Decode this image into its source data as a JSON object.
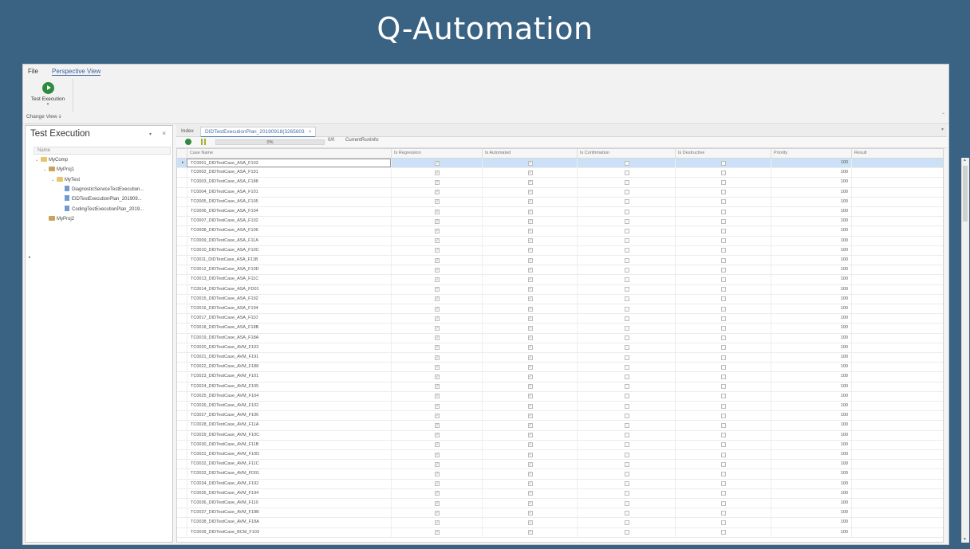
{
  "banner": {
    "title": "Q-Automation"
  },
  "menu": {
    "file": "File",
    "perspective": "Perspective View"
  },
  "ribbon": {
    "run_label": "Test Execution",
    "group_label": "Change View",
    "group_icon": "ↆ"
  },
  "left_panel": {
    "title": "Test Execution",
    "header": "Name",
    "tree": [
      {
        "label": "MyComp",
        "level": 0,
        "icon": "folder",
        "expander": "v"
      },
      {
        "label": "MyProj1",
        "level": 1,
        "icon": "project",
        "expander": "v"
      },
      {
        "label": "MyTest",
        "level": 2,
        "icon": "folder",
        "expander": "v"
      },
      {
        "label": "DiagnosticServiceTestExecution...",
        "level": 3,
        "icon": "file",
        "expander": ""
      },
      {
        "label": "EIDTestExecutionPlan_201909...",
        "level": 3,
        "icon": "file",
        "expander": ""
      },
      {
        "label": "CodingTestExecutionPlan_2019...",
        "level": 3,
        "icon": "file",
        "expander": ""
      },
      {
        "label": "MyProj2",
        "level": 1,
        "icon": "project",
        "expander": ""
      }
    ]
  },
  "tabs": {
    "index": "Index",
    "active": "DIDTestExecutionPlan_20190918(3265603",
    "close": "×"
  },
  "toolbar": {
    "progress": 0,
    "progress_label": "0%",
    "run_count": "0/0",
    "run_info": "CurrentRunInfo:"
  },
  "grid": {
    "columns": [
      "Case Name",
      "Is Regression",
      "Is Automated",
      "Is Confirmation",
      "Is Destructive",
      "Priority",
      "Result"
    ],
    "rows": [
      {
        "name": "TC0001_DIDTestCase_ASA_F103",
        "reg": true,
        "auto": true,
        "conf": false,
        "dest": false,
        "prio": "100"
      },
      {
        "name": "TC0002_DIDTestCase_ASA_F191",
        "reg": true,
        "auto": true,
        "conf": false,
        "dest": false,
        "prio": "100"
      },
      {
        "name": "TC0003_DIDTestCase_ASA_F188",
        "reg": true,
        "auto": true,
        "conf": false,
        "dest": false,
        "prio": "100"
      },
      {
        "name": "TC0004_DIDTestCase_ASA_F101",
        "reg": true,
        "auto": true,
        "conf": false,
        "dest": false,
        "prio": "100"
      },
      {
        "name": "TC0005_DIDTestCase_ASA_F105",
        "reg": true,
        "auto": true,
        "conf": false,
        "dest": false,
        "prio": "100"
      },
      {
        "name": "TC0006_DIDTestCase_ASA_F104",
        "reg": true,
        "auto": true,
        "conf": false,
        "dest": false,
        "prio": "100"
      },
      {
        "name": "TC0007_DIDTestCase_ASA_F102",
        "reg": true,
        "auto": true,
        "conf": false,
        "dest": false,
        "prio": "100"
      },
      {
        "name": "TC0008_DIDTestCase_ASA_F106",
        "reg": true,
        "auto": true,
        "conf": false,
        "dest": false,
        "prio": "100"
      },
      {
        "name": "TC0009_DIDTestCase_ASA_F11A",
        "reg": true,
        "auto": true,
        "conf": false,
        "dest": false,
        "prio": "100"
      },
      {
        "name": "TC0010_DIDTestCase_ASA_F10C",
        "reg": true,
        "auto": true,
        "conf": false,
        "dest": false,
        "prio": "100"
      },
      {
        "name": "TC0011_DIDTestCase_ASA_F11B",
        "reg": true,
        "auto": true,
        "conf": false,
        "dest": false,
        "prio": "100"
      },
      {
        "name": "TC0012_DIDTestCase_ASA_F10D",
        "reg": true,
        "auto": true,
        "conf": false,
        "dest": false,
        "prio": "100"
      },
      {
        "name": "TC0013_DIDTestCase_ASA_F11C",
        "reg": true,
        "auto": true,
        "conf": false,
        "dest": false,
        "prio": "100"
      },
      {
        "name": "TC0014_DIDTestCase_ASA_FD01",
        "reg": true,
        "auto": true,
        "conf": false,
        "dest": false,
        "prio": "100"
      },
      {
        "name": "TC0015_DIDTestCase_ASA_F192",
        "reg": true,
        "auto": true,
        "conf": false,
        "dest": false,
        "prio": "100"
      },
      {
        "name": "TC0016_DIDTestCase_ASA_F194",
        "reg": true,
        "auto": true,
        "conf": false,
        "dest": false,
        "prio": "100"
      },
      {
        "name": "TC0017_DIDTestCase_ASA_F110",
        "reg": true,
        "auto": true,
        "conf": false,
        "dest": false,
        "prio": "100"
      },
      {
        "name": "TC0018_DIDTestCase_ASA_F18B",
        "reg": true,
        "auto": true,
        "conf": false,
        "dest": false,
        "prio": "100"
      },
      {
        "name": "TC0019_DIDTestCase_ASA_F18A",
        "reg": true,
        "auto": true,
        "conf": false,
        "dest": false,
        "prio": "100"
      },
      {
        "name": "TC0020_DIDTestCase_AVM_F103",
        "reg": true,
        "auto": true,
        "conf": false,
        "dest": false,
        "prio": "100"
      },
      {
        "name": "TC0021_DIDTestCase_AVM_F191",
        "reg": true,
        "auto": true,
        "conf": false,
        "dest": false,
        "prio": "100"
      },
      {
        "name": "TC0022_DIDTestCase_AVM_F188",
        "reg": true,
        "auto": true,
        "conf": false,
        "dest": false,
        "prio": "100"
      },
      {
        "name": "TC0023_DIDTestCase_AVM_F101",
        "reg": true,
        "auto": true,
        "conf": false,
        "dest": false,
        "prio": "100"
      },
      {
        "name": "TC0024_DIDTestCase_AVM_F105",
        "reg": true,
        "auto": true,
        "conf": false,
        "dest": false,
        "prio": "100"
      },
      {
        "name": "TC0025_DIDTestCase_AVM_F104",
        "reg": true,
        "auto": true,
        "conf": false,
        "dest": false,
        "prio": "100"
      },
      {
        "name": "TC0026_DIDTestCase_AVM_F102",
        "reg": true,
        "auto": true,
        "conf": false,
        "dest": false,
        "prio": "100"
      },
      {
        "name": "TC0027_DIDTestCase_AVM_F106",
        "reg": true,
        "auto": true,
        "conf": false,
        "dest": false,
        "prio": "100"
      },
      {
        "name": "TC0028_DIDTestCase_AVM_F11A",
        "reg": true,
        "auto": true,
        "conf": false,
        "dest": false,
        "prio": "100"
      },
      {
        "name": "TC0029_DIDTestCase_AVM_F10C",
        "reg": true,
        "auto": true,
        "conf": false,
        "dest": false,
        "prio": "100"
      },
      {
        "name": "TC0030_DIDTestCase_AVM_F11B",
        "reg": true,
        "auto": true,
        "conf": false,
        "dest": false,
        "prio": "100"
      },
      {
        "name": "TC0031_DIDTestCase_AVM_F10D",
        "reg": true,
        "auto": true,
        "conf": false,
        "dest": false,
        "prio": "100"
      },
      {
        "name": "TC0032_DIDTestCase_AVM_F11C",
        "reg": true,
        "auto": true,
        "conf": false,
        "dest": false,
        "prio": "100"
      },
      {
        "name": "TC0033_DIDTestCase_AVM_FD01",
        "reg": true,
        "auto": true,
        "conf": false,
        "dest": false,
        "prio": "100"
      },
      {
        "name": "TC0034_DIDTestCase_AVM_F192",
        "reg": true,
        "auto": true,
        "conf": false,
        "dest": false,
        "prio": "100"
      },
      {
        "name": "TC0035_DIDTestCase_AVM_F194",
        "reg": true,
        "auto": true,
        "conf": false,
        "dest": false,
        "prio": "100"
      },
      {
        "name": "TC0036_DIDTestCase_AVM_F110",
        "reg": true,
        "auto": true,
        "conf": false,
        "dest": false,
        "prio": "100"
      },
      {
        "name": "TC0037_DIDTestCase_AVM_F18B",
        "reg": true,
        "auto": true,
        "conf": false,
        "dest": false,
        "prio": "100"
      },
      {
        "name": "TC0038_DIDTestCase_AVM_F18A",
        "reg": true,
        "auto": true,
        "conf": false,
        "dest": false,
        "prio": "100"
      },
      {
        "name": "TC0039_DIDTestCase_BCM_F103",
        "reg": true,
        "auto": true,
        "conf": false,
        "dest": false,
        "prio": "100"
      }
    ]
  },
  "colors": {
    "banner_bg": "#3a6283",
    "accent": "#4a7ab5",
    "run_green": "#2e8b3e",
    "selected_row": "#cce1f7"
  },
  "icons": {
    "run": "play-circle-icon",
    "pause": "pause-icon",
    "folder": "folder-icon",
    "file": "file-icon"
  }
}
